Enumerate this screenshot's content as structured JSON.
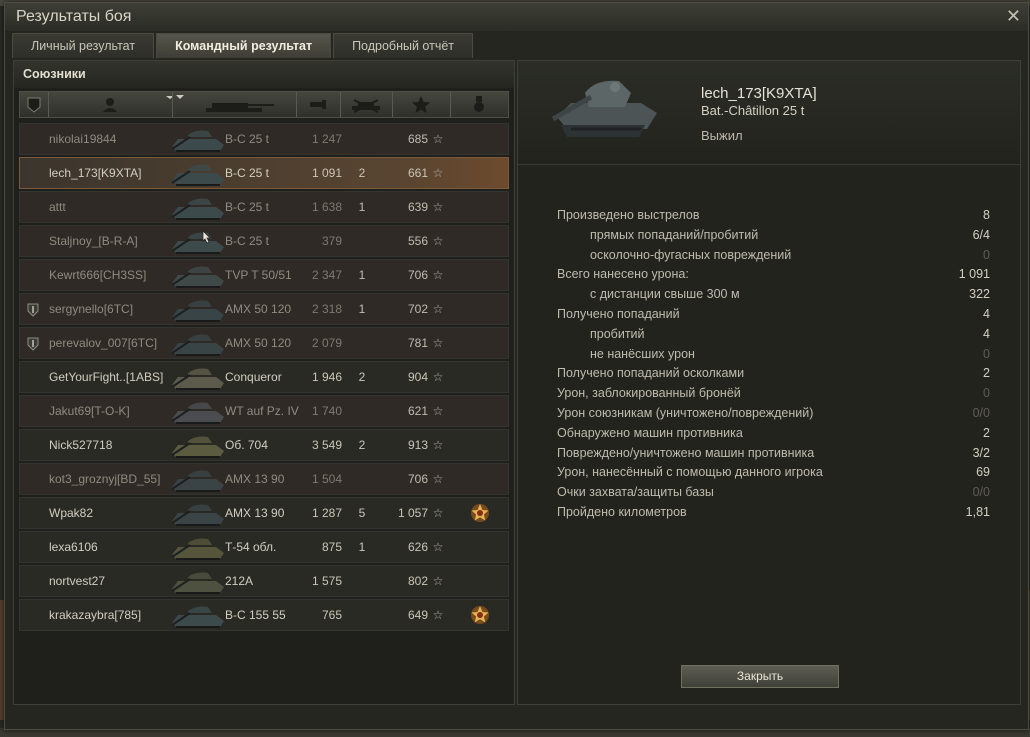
{
  "window": {
    "title": "Результаты боя",
    "close_glyph": "✕"
  },
  "tabs": [
    {
      "label": "Личный результат"
    },
    {
      "label": "Командный результат",
      "active": true
    },
    {
      "label": "Подробный отчёт"
    }
  ],
  "team": {
    "header": "Союзники",
    "columns": [
      "clan-icon",
      "player-icon",
      "tank-icon",
      "damage-icon",
      "kills-icon",
      "xp-star-icon",
      "medal-icon"
    ],
    "rows": [
      {
        "name": "nikolai19844",
        "vehicle": "В-С 25 t",
        "damage": "1 247",
        "kills": "",
        "xp": "685",
        "alive": false,
        "clan": false,
        "medal": false,
        "tank_color": "#3d4a4c"
      },
      {
        "name": "lech_173[K9XTA]",
        "vehicle": "В-С 25 t",
        "damage": "1 091",
        "kills": "2",
        "xp": "661",
        "alive": true,
        "selected": true,
        "clan": false,
        "medal": false,
        "tank_color": "#3d4a4c"
      },
      {
        "name": "attt",
        "vehicle": "В-С 25 t",
        "damage": "1 638",
        "kills": "1",
        "xp": "639",
        "alive": false,
        "clan": false,
        "medal": false,
        "tank_color": "#3d4a4c"
      },
      {
        "name": "Staljnoy_[B-R-A]",
        "vehicle": "В-С 25 t",
        "damage": "379",
        "kills": "",
        "xp": "556",
        "alive": false,
        "clan": false,
        "medal": false,
        "tank_color": "#3d4a4c"
      },
      {
        "name": "Kewrt666[CH3SS]",
        "vehicle": "TVP T 50/51",
        "damage": "2 347",
        "kills": "1",
        "xp": "706",
        "alive": false,
        "clan": false,
        "medal": false,
        "tank_color": "#3f4a48"
      },
      {
        "name": "sergynello[6TC]",
        "vehicle": "AMX 50 120",
        "damage": "2 318",
        "kills": "1",
        "xp": "702",
        "alive": false,
        "clan": true,
        "medal": false,
        "tank_color": "#394446"
      },
      {
        "name": "perevalov_007[6TC]",
        "vehicle": "AMX 50 120",
        "damage": "2 079",
        "kills": "",
        "xp": "781",
        "alive": false,
        "clan": true,
        "medal": false,
        "tank_color": "#394446"
      },
      {
        "name": "GetYourFight..[1ABS]",
        "vehicle": "Conqueror",
        "damage": "1 946",
        "kills": "2",
        "xp": "904",
        "alive": true,
        "clan": false,
        "medal": false,
        "tank_color": "#5c5a4a"
      },
      {
        "name": "Jakut69[T-O-K]",
        "vehicle": "WT auf Pz. IV",
        "damage": "1 740",
        "kills": "",
        "xp": "621",
        "alive": true,
        "dead_bg": true,
        "clan": false,
        "medal": false,
        "tank_color": "#4a4c50"
      },
      {
        "name": "Nick527718",
        "vehicle": "Об. 704",
        "damage": "3 549",
        "kills": "2",
        "xp": "913",
        "alive": true,
        "clan": false,
        "medal": false,
        "tank_color": "#5b5b40"
      },
      {
        "name": "kot3_groznyj[BD_55]",
        "vehicle": "AMX 13 90",
        "damage": "1 504",
        "kills": "",
        "xp": "706",
        "alive": false,
        "clan": false,
        "medal": false,
        "tank_color": "#3a4446"
      },
      {
        "name": "Wpak82",
        "vehicle": "AMX 13 90",
        "damage": "1 287",
        "kills": "5",
        "xp": "1 057",
        "alive": true,
        "clan": false,
        "medal": true,
        "tank_color": "#3a4446"
      },
      {
        "name": "lexa6106",
        "vehicle": "Т-54 обл.",
        "damage": "875",
        "kills": "1",
        "xp": "626",
        "alive": true,
        "clan": false,
        "medal": false,
        "tank_color": "#55553c"
      },
      {
        "name": "nortvest27",
        "vehicle": "212А",
        "damage": "1 575",
        "kills": "",
        "xp": "802",
        "alive": true,
        "clan": false,
        "medal": false,
        "tank_color": "#4e5040"
      },
      {
        "name": "krakazaybra[785]",
        "vehicle": "B-C 155 55",
        "damage": "765",
        "kills": "",
        "xp": "649",
        "alive": true,
        "clan": false,
        "medal": true,
        "tank_color": "#3d4a4c"
      }
    ]
  },
  "detail": {
    "player": "lech_173[K9XTA]",
    "vehicle": "Bat.-Châtillon 25 t",
    "status": "Выжил",
    "stats": [
      {
        "label": "Произведено выстрелов",
        "value": "8",
        "sub": false
      },
      {
        "label": "прямых попаданий/пробитий",
        "value": "6/4",
        "sub": true
      },
      {
        "label": "осколочно-фугасных повреждений",
        "value": "0",
        "sub": true,
        "zero": true
      },
      {
        "label": "Всего нанесено урона:",
        "value": "1 091",
        "sub": false
      },
      {
        "label": "с дистанции свыше 300 м",
        "value": "322",
        "sub": true
      },
      {
        "label": "Получено попаданий",
        "value": "4",
        "sub": false
      },
      {
        "label": "пробитий",
        "value": "4",
        "sub": true
      },
      {
        "label": "не нанёсших урон",
        "value": "0",
        "sub": true,
        "zero": true
      },
      {
        "label": "Получено попаданий осколками",
        "value": "2",
        "sub": false
      },
      {
        "label": "Урон, заблокированный бронёй",
        "value": "0",
        "sub": false,
        "zero": true
      },
      {
        "label": "Урон союзникам (уничтожено/повреждений)",
        "value": "0/0",
        "sub": false,
        "zero": true
      },
      {
        "label": "Обнаружено машин противника",
        "value": "2",
        "sub": false
      },
      {
        "label": "Повреждено/уничтожено машин противника",
        "value": "3/2",
        "sub": false
      },
      {
        "label": "Урон, нанесённый с помощью данного игрока",
        "value": "69",
        "sub": false
      },
      {
        "label": "Очки захвата/защиты базы",
        "value": "0/0",
        "sub": false,
        "zero": true
      },
      {
        "label": "Пройдено километров",
        "value": "1,81",
        "sub": false
      }
    ],
    "close_label": "Закрыть"
  },
  "colors": {
    "selected_row": "#5a4531",
    "dead_row": "#2f2a25",
    "text_alive": "#d1cec1",
    "text_dead": "#8f8b80"
  }
}
